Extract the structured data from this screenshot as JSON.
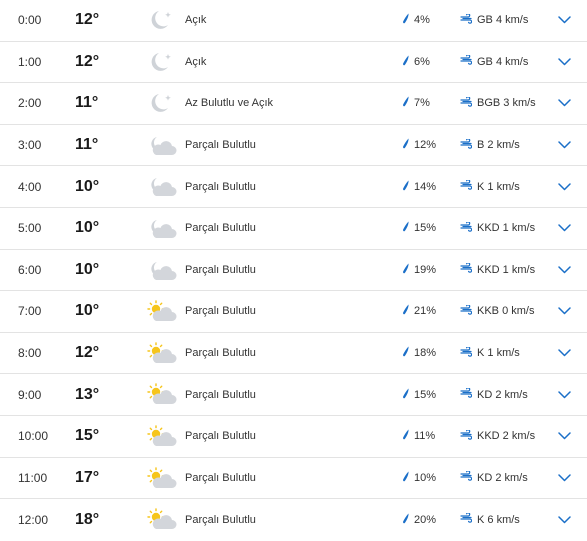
{
  "colors": {
    "accent": "#1b6fc8",
    "moon": "#cfd3d8",
    "sun": "#f6c51b",
    "cloud": "#d3d6db",
    "divider": "#e3e3e3"
  },
  "rows": [
    {
      "time": "0:00",
      "temp": "12°",
      "icon": "moon-icon",
      "condition": "Açık",
      "precip": "4%",
      "wind": "GB 4 km/s"
    },
    {
      "time": "1:00",
      "temp": "12°",
      "icon": "moon-icon",
      "condition": "Açık",
      "precip": "6%",
      "wind": "GB 4 km/s"
    },
    {
      "time": "2:00",
      "temp": "11°",
      "icon": "moon-icon",
      "condition": "Az Bulutlu ve Açık",
      "precip": "7%",
      "wind": "BGB 3 km/s"
    },
    {
      "time": "3:00",
      "temp": "11°",
      "icon": "moon-cloud-icon",
      "condition": "Parçalı Bulutlu",
      "precip": "12%",
      "wind": "B 2 km/s"
    },
    {
      "time": "4:00",
      "temp": "10°",
      "icon": "moon-cloud-icon",
      "condition": "Parçalı Bulutlu",
      "precip": "14%",
      "wind": "K 1 km/s"
    },
    {
      "time": "5:00",
      "temp": "10°",
      "icon": "moon-cloud-icon",
      "condition": "Parçalı Bulutlu",
      "precip": "15%",
      "wind": "KKD 1 km/s"
    },
    {
      "time": "6:00",
      "temp": "10°",
      "icon": "moon-cloud-icon",
      "condition": "Parçalı Bulutlu",
      "precip": "19%",
      "wind": "KKD 1 km/s"
    },
    {
      "time": "7:00",
      "temp": "10°",
      "icon": "sun-cloud-icon",
      "condition": "Parçalı Bulutlu",
      "precip": "21%",
      "wind": "KKB 0 km/s"
    },
    {
      "time": "8:00",
      "temp": "12°",
      "icon": "sun-cloud-icon",
      "condition": "Parçalı Bulutlu",
      "precip": "18%",
      "wind": "K 1 km/s"
    },
    {
      "time": "9:00",
      "temp": "13°",
      "icon": "sun-cloud-icon",
      "condition": "Parçalı Bulutlu",
      "precip": "15%",
      "wind": "KD 2 km/s"
    },
    {
      "time": "10:00",
      "temp": "15°",
      "icon": "sun-cloud-icon",
      "condition": "Parçalı Bulutlu",
      "precip": "11%",
      "wind": "KKD 2 km/s"
    },
    {
      "time": "11:00",
      "temp": "17°",
      "icon": "sun-cloud-icon",
      "condition": "Parçalı Bulutlu",
      "precip": "10%",
      "wind": "KD 2 km/s"
    },
    {
      "time": "12:00",
      "temp": "18°",
      "icon": "sun-cloud-icon",
      "condition": "Parçalı Bulutlu",
      "precip": "20%",
      "wind": "K 6 km/s"
    }
  ]
}
